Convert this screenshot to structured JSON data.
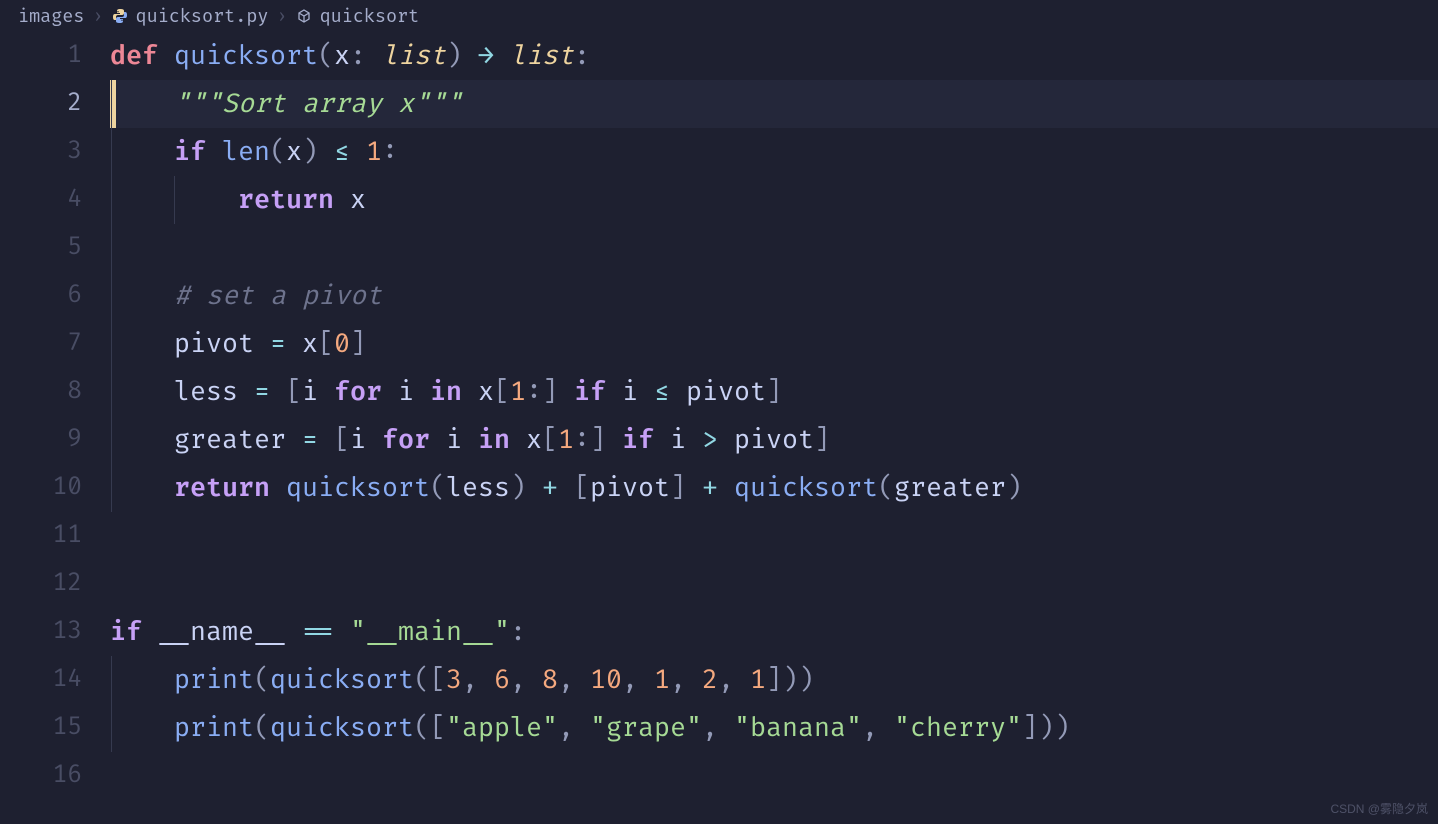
{
  "breadcrumb": {
    "folder": "images",
    "file": "quicksort.py",
    "symbol": "quicksort"
  },
  "lines": [
    1,
    2,
    3,
    4,
    5,
    6,
    7,
    8,
    9,
    10,
    11,
    12,
    13,
    14,
    15,
    16
  ],
  "active_line": 2,
  "code": {
    "l1": {
      "def": "def",
      "fn": "quicksort",
      "lp": "(",
      "p": "x",
      "colon1": ": ",
      "t1": "list",
      "rp": ") ",
      "arrow": "→ ",
      "t2": "list",
      "colon2": ":"
    },
    "l2": {
      "doc": "\"\"\"Sort array x\"\"\""
    },
    "l3": {
      "if": "if",
      "len": "len",
      "lp": "(",
      "x": "x",
      "rp": ") ",
      "op": "≤ ",
      "n": "1",
      "c": ":"
    },
    "l4": {
      "ret": "return",
      "x": "x"
    },
    "l6": {
      "cmt": "# set a pivot"
    },
    "l7": {
      "v": "pivot ",
      "eq": "= ",
      "x": "x",
      "lb": "[",
      "n": "0",
      "rb": "]"
    },
    "l8": {
      "v": "less ",
      "eq": "= ",
      "lb": "[",
      "i1": "i ",
      "for": "for",
      "i2": " i ",
      "in": "in",
      "x": " x",
      "lb2": "[",
      "n": "1",
      "sl": ":",
      "rb2": "] ",
      "if": "if",
      "i3": " i ",
      "op": "≤ ",
      "pv": "pivot",
      "rb": "]"
    },
    "l9": {
      "v": "greater ",
      "eq": "= ",
      "lb": "[",
      "i1": "i ",
      "for": "for",
      "i2": " i ",
      "in": "in",
      "x": " x",
      "lb2": "[",
      "n": "1",
      "sl": ":",
      "rb2": "] ",
      "if": "if",
      "i3": " i ",
      "op": "> ",
      "pv": "pivot",
      "rb": "]"
    },
    "l10": {
      "ret": "return",
      "fn1": "quicksort",
      "lp1": "(",
      "a1": "less",
      "rp1": ") ",
      "p1": "+ ",
      "lb": "[",
      "pv": "pivot",
      "rb": "] ",
      "p2": "+ ",
      "fn2": "quicksort",
      "lp2": "(",
      "a2": "greater",
      "rp2": ")"
    },
    "l13": {
      "if": "if",
      "name": " __name__ ",
      "eq": "== ",
      "s": "\"__main__\"",
      "c": ":"
    },
    "l14": {
      "pr": "print",
      "lp": "(",
      "fn": "quicksort",
      "lp2": "(",
      "lb": "[",
      "n1": "3",
      "c1": ", ",
      "n2": "6",
      "c2": ", ",
      "n3": "8",
      "c3": ", ",
      "n4": "10",
      "c4": ", ",
      "n5": "1",
      "c5": ", ",
      "n6": "2",
      "c6": ", ",
      "n7": "1",
      "rb": "]",
      "rp2": ")",
      "rp": ")"
    },
    "l15": {
      "pr": "print",
      "lp": "(",
      "fn": "quicksort",
      "lp2": "(",
      "lb": "[",
      "s1": "\"apple\"",
      "c1": ", ",
      "s2": "\"grape\"",
      "c2": ", ",
      "s3": "\"banana\"",
      "c3": ", ",
      "s4": "\"cherry\"",
      "rb": "]",
      "rp2": ")",
      "rp": ")"
    }
  },
  "watermark": "CSDN @雾隐夕岚"
}
